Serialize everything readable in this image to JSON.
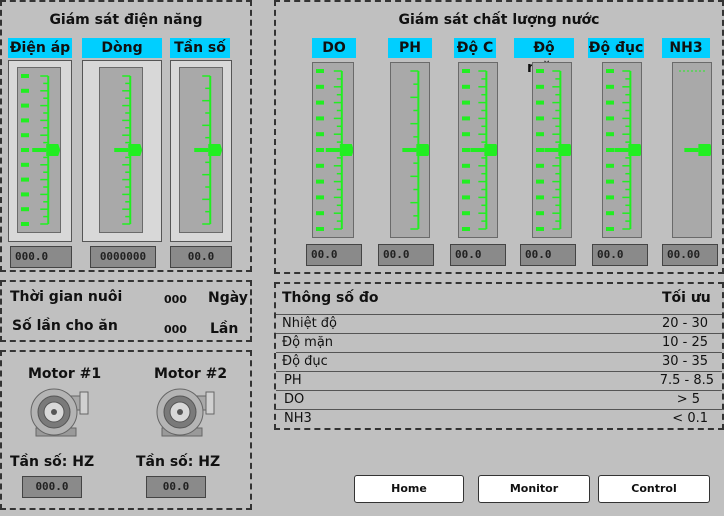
{
  "power_panel": {
    "title": "Giám sát điện năng",
    "gauges": [
      {
        "label": "Điện áp",
        "value": "000.0"
      },
      {
        "label": "Dòng điện",
        "value": "0000000"
      },
      {
        "label": "Tần số",
        "value": "00.0"
      }
    ]
  },
  "water_panel": {
    "title": "Giám sát chất lượng nước",
    "gauges": [
      {
        "label": "DO",
        "value": "00.0"
      },
      {
        "label": "PH",
        "value": "00.0"
      },
      {
        "label": "Độ C",
        "value": "00.0"
      },
      {
        "label": "Độ mặn",
        "value": "00.0"
      },
      {
        "label": "Độ đục",
        "value": "00.0"
      },
      {
        "label": "NH3",
        "value": "00.00"
      }
    ]
  },
  "info_panel": {
    "rows": [
      {
        "label": "Thời gian nuôi",
        "value": "000",
        "unit": "Ngày"
      },
      {
        "label": "Số lần cho ăn",
        "value": "000",
        "unit": "Lần"
      }
    ]
  },
  "motor_panel": {
    "motors": [
      {
        "name": "Motor #1",
        "freq_label": "Tần số: HZ",
        "value": "000.0"
      },
      {
        "name": "Motor #2",
        "freq_label": "Tần số: HZ",
        "value": "00.0"
      }
    ]
  },
  "params_table": {
    "header_left": "Thông số đo",
    "header_right": "Tối ưu",
    "rows": [
      {
        "name": "Nhiệt độ",
        "range": "20 - 30"
      },
      {
        "name": "Độ mặn",
        "range": "10 - 25"
      },
      {
        "name": "Độ đục",
        "range": "30 - 35"
      },
      {
        "name": "PH",
        "range": "7.5 - 8.5"
      },
      {
        "name": "DO",
        "range": "> 5"
      },
      {
        "name": "NH3",
        "range": "< 0.1"
      }
    ]
  },
  "nav": {
    "home": "Home",
    "monitor": "Monitor",
    "control": "Control"
  },
  "colors": {
    "accent": "#00cfff",
    "scale": "#22ee22",
    "background": "#c0c0c0"
  }
}
